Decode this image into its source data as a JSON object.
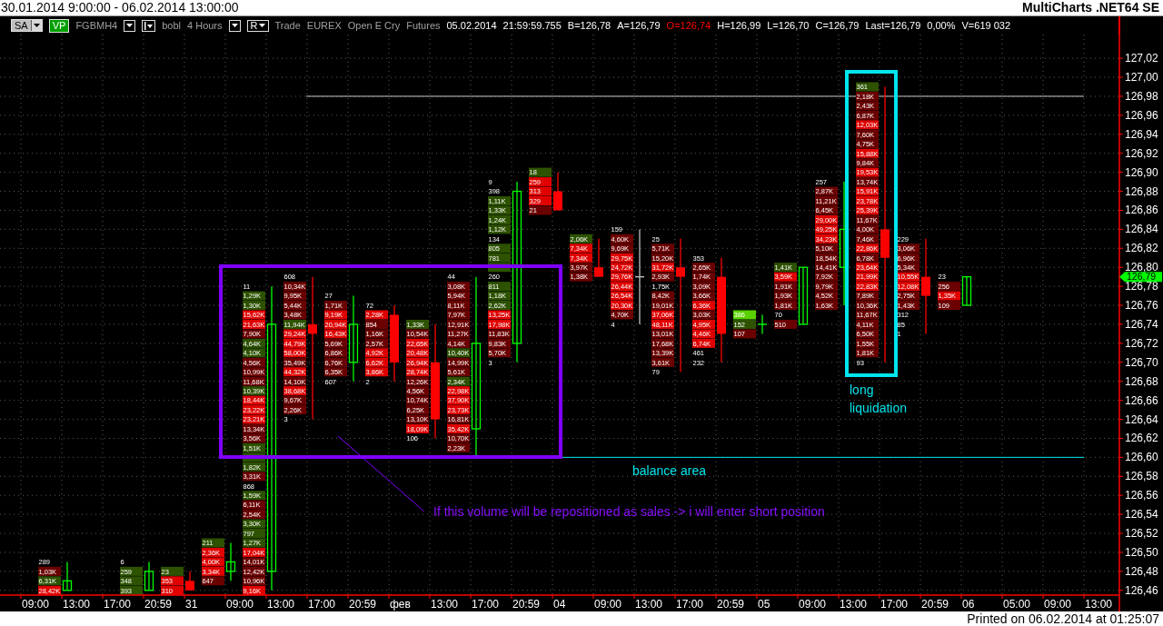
{
  "header": {
    "range": "30.01.2014 9:00:00 - 06.02.2014 13:00:00",
    "app": "MultiCharts .NET64 SE"
  },
  "toolbar": {
    "items": [
      {
        "kind": "dropdown",
        "label": "SA"
      },
      {
        "kind": "toggle",
        "label": "VP",
        "on": true
      },
      {
        "kind": "text",
        "text": "FGBMH4",
        "color": "#a0a0a0"
      },
      {
        "kind": "caret"
      },
      {
        "kind": "bar-caret"
      },
      {
        "kind": "text",
        "text": "bobl",
        "color": "#a0a0a0"
      },
      {
        "kind": "text",
        "text": "4 Hours",
        "color": "#a0a0a0"
      },
      {
        "kind": "caret"
      },
      {
        "kind": "letter-caret",
        "label": "R"
      },
      {
        "kind": "text",
        "text": "Trade",
        "color": "#a0a0a0"
      },
      {
        "kind": "text",
        "text": "EUREX",
        "color": "#a0a0a0"
      },
      {
        "kind": "text",
        "text": "Open E Cry",
        "color": "#a0a0a0"
      },
      {
        "kind": "text",
        "text": "Futures",
        "color": "#a0a0a0"
      },
      {
        "kind": "text",
        "text": "05.02.2014",
        "color": "#ffffff"
      },
      {
        "kind": "text",
        "text": "21:59:59.755",
        "color": "#ffffff"
      },
      {
        "kind": "text",
        "text": "B=126,78",
        "color": "#ffffff"
      },
      {
        "kind": "text",
        "text": "A=126,79",
        "color": "#ffffff"
      },
      {
        "kind": "text",
        "text": "O=126,74",
        "color": "#ff0000"
      },
      {
        "kind": "text",
        "text": "H=126,99",
        "color": "#ffffff"
      },
      {
        "kind": "text",
        "text": "L=126,70",
        "color": "#ffffff"
      },
      {
        "kind": "text",
        "text": "C=126,79",
        "color": "#ffffff"
      },
      {
        "kind": "text",
        "text": "Last=126,79",
        "color": "#ffffff"
      },
      {
        "kind": "text",
        "text": "0,00%",
        "color": "#ffffff"
      },
      {
        "kind": "text",
        "text": "V=619 032",
        "color": "#ffffff"
      }
    ]
  },
  "chart": {
    "last_price": "126,79",
    "chart_data": [
      {
        "type": "candlestick",
        "categories": [
          "09:00",
          "13:00",
          "17:00",
          "20:59",
          "31",
          "09:00",
          "13:00",
          "17:00",
          "20:59",
          "фев",
          "13:00",
          "17:00",
          "20:59",
          "04",
          "09:00",
          "13:00",
          "17:00",
          "20:59",
          "05",
          "09:00",
          "13:00",
          "17:00",
          "20:59",
          "06",
          "05:00",
          "09:00",
          "13:00"
        ],
        "ohlc": [
          null,
          [
            126.46,
            126.49,
            126.46,
            126.47
          ],
          null,
          [
            126.46,
            126.49,
            126.46,
            126.48
          ],
          [
            126.47,
            126.48,
            126.46,
            126.46
          ],
          [
            126.48,
            126.51,
            126.47,
            126.49
          ],
          [
            126.48,
            126.78,
            126.46,
            126.74
          ],
          [
            126.74,
            126.79,
            126.64,
            126.73
          ],
          [
            126.7,
            126.77,
            126.68,
            126.74
          ],
          [
            126.75,
            126.76,
            126.68,
            126.7
          ],
          [
            126.7,
            126.74,
            126.62,
            126.64
          ],
          [
            126.63,
            126.79,
            126.6,
            126.72
          ],
          [
            126.72,
            126.89,
            126.7,
            126.88
          ],
          [
            126.88,
            126.9,
            126.86,
            126.86
          ],
          [
            126.8,
            126.83,
            126.79,
            126.79
          ],
          [
            126.79,
            126.84,
            126.74,
            126.79
          ],
          [
            126.8,
            126.83,
            126.69,
            126.79
          ],
          [
            126.79,
            126.81,
            126.7,
            126.73
          ],
          [
            126.74,
            126.75,
            126.73,
            126.74
          ],
          [
            126.74,
            126.8,
            126.74,
            126.8
          ],
          [
            126.8,
            126.89,
            126.76,
            126.84
          ],
          [
            126.84,
            126.99,
            126.7,
            126.81
          ],
          [
            126.79,
            126.83,
            126.73,
            126.77
          ],
          [
            126.76,
            126.79,
            126.76,
            126.79
          ],
          null,
          null,
          null
        ],
        "colors": [
          null,
          "#00ff00",
          null,
          "#00ff00",
          "#ff0000",
          "#00ff00",
          "#00ff00",
          "#ff0000",
          "#00ff00",
          "#ff0000",
          "#ff0000",
          "#00ff00",
          "#00ff00",
          "#ff0000",
          "#ff0000",
          "#c0c0c0",
          "#ff0000",
          "#ff0000",
          "#00ff00",
          "#00ff00",
          "#00ff00",
          "#ff0000",
          "#ff0000",
          "#00ff00",
          null,
          null,
          null
        ],
        "value_labels": [
          null,
          [
            {
              "text": "289"
            },
            {
              "text": "1,03K",
              "color": "#6b0000"
            },
            {
              "text": "6,31K",
              "color": "#2d5200"
            },
            {
              "text": "28,42K",
              "color": "#e00000"
            }
          ],
          null,
          [
            {
              "text": "6"
            },
            {
              "text": "259",
              "color": "#2d5200"
            },
            {
              "text": "348",
              "color": "#2d5200"
            },
            {
              "text": "393",
              "color": "#2d5200"
            }
          ],
          [
            {
              "text": "23",
              "color": "#2d5200"
            },
            {
              "text": "353",
              "color": "#e00000"
            },
            {
              "text": "310",
              "color": "#e00000"
            }
          ],
          [
            {
              "text": "211",
              "color": "#2d5200"
            },
            {
              "text": "2,36K",
              "color": "#e00000"
            },
            {
              "text": "4,00K",
              "color": "#e00000"
            },
            {
              "text": "3,34K",
              "color": "#e00000"
            },
            {
              "text": "647",
              "color": "#6b0000"
            }
          ],
          [
            {
              "text": "11"
            },
            {
              "text": "1,29K",
              "color": "#2d5200"
            },
            {
              "text": "1,30K",
              "color": "#2d5200"
            },
            {
              "text": "15,62K",
              "color": "#e00000"
            },
            {
              "text": "21,63K",
              "color": "#e00000"
            },
            {
              "text": "7,90K",
              "color": "#6b0000"
            },
            {
              "text": "4,64K",
              "color": "#2d5200"
            },
            {
              "text": "4,10K",
              "color": "#2d5200"
            },
            {
              "text": "4,56K",
              "color": "#6b0000"
            },
            {
              "text": "10,99K",
              "color": "#6b0000"
            },
            {
              "text": "11,68K",
              "color": "#6b0000"
            },
            {
              "text": "10,39K",
              "color": "#2d5200"
            },
            {
              "text": "18,44K",
              "color": "#e00000"
            },
            {
              "text": "23,22K",
              "color": "#e00000"
            },
            {
              "text": "23,21K",
              "color": "#e00000"
            },
            {
              "text": "13,34K",
              "color": "#6b0000"
            },
            {
              "text": "3,56K",
              "color": "#6b0000"
            },
            {
              "text": "1,51K",
              "color": "#2d5200"
            },
            {
              "color": "#2d5200"
            },
            {
              "text": "1,82K",
              "color": "#2d5200"
            },
            {
              "text": "3,31K",
              "color": "#6b0000"
            },
            {
              "text": "868"
            },
            {
              "text": "1,59K",
              "color": "#2d5200"
            },
            {
              "text": "6,11K",
              "color": "#6b0000"
            },
            {
              "text": "2,54K",
              "color": "#6b0000"
            },
            {
              "text": "3,30K",
              "color": "#2d5200"
            },
            {
              "text": "797",
              "color": "#2d5200"
            },
            {
              "text": "1,27K",
              "color": "#2d5200"
            },
            {
              "text": "17,04K",
              "color": "#e00000"
            },
            {
              "text": "14,01K",
              "color": "#6b0000"
            },
            {
              "text": "12,42K",
              "color": "#6b0000"
            },
            {
              "text": "10,96K",
              "color": "#6b0000"
            },
            {
              "text": "9,16K",
              "color": "#e00000"
            }
          ],
          [
            {
              "text": "608"
            },
            {
              "text": "10,34K",
              "color": "#6b0000"
            },
            {
              "text": "9,95K",
              "color": "#6b0000"
            },
            {
              "text": "5,44K",
              "color": "#6b0000"
            },
            {
              "text": "3,48K",
              "color": "#6b0000"
            },
            {
              "text": "11,94K",
              "color": "#2d5200"
            },
            {
              "text": "29,24K",
              "color": "#e00000"
            },
            {
              "text": "44,79K",
              "color": "#e00000"
            },
            {
              "text": "58,00K",
              "color": "#e00000"
            },
            {
              "text": "35,49K",
              "color": "#6b0000"
            },
            {
              "text": "44,32K",
              "color": "#e00000"
            },
            {
              "text": "14,10K",
              "color": "#6b0000"
            },
            {
              "text": "38,68K",
              "color": "#e00000"
            },
            {
              "text": "9,67K",
              "color": "#6b0000"
            },
            {
              "text": "2,26K",
              "color": "#6b0000"
            },
            {
              "text": "3"
            }
          ],
          [
            {
              "text": "27"
            },
            {
              "text": "1,71K",
              "color": "#6b0000"
            },
            {
              "text": "9,19K",
              "color": "#e00000"
            },
            {
              "text": "20,94K",
              "color": "#e00000"
            },
            {
              "text": "16,43K",
              "color": "#e00000"
            },
            {
              "text": "5,69K",
              "color": "#6b0000"
            },
            {
              "text": "6,86K",
              "color": "#6b0000"
            },
            {
              "text": "6,76K",
              "color": "#6b0000"
            },
            {
              "text": "6,35K",
              "color": "#6b0000"
            },
            {
              "text": "607"
            }
          ],
          [
            {
              "text": "72"
            },
            {
              "text": "2,28K",
              "color": "#e00000"
            },
            {
              "text": "854",
              "color": "#6b0000"
            },
            {
              "text": "1,16K",
              "color": "#6b0000"
            },
            {
              "text": "2,57K",
              "color": "#6b0000"
            },
            {
              "text": "4,92K",
              "color": "#e00000"
            },
            {
              "text": "6,62K",
              "color": "#e00000"
            },
            {
              "text": "3,86K",
              "color": "#e00000"
            },
            {
              "text": "2"
            }
          ],
          [
            {
              "text": "1,33K",
              "color": "#2d5200"
            },
            {
              "text": "10,54K",
              "color": "#6b0000"
            },
            {
              "text": "22,65K",
              "color": "#e00000"
            },
            {
              "text": "20,48K",
              "color": "#e00000"
            },
            {
              "text": "26,94K",
              "color": "#e00000"
            },
            {
              "text": "28,74K",
              "color": "#e00000"
            },
            {
              "text": "12,26K",
              "color": "#6b0000"
            },
            {
              "text": "4,56K",
              "color": "#6b0000"
            },
            {
              "text": "10,74K",
              "color": "#6b0000"
            },
            {
              "text": "6,25K",
              "color": "#6b0000"
            },
            {
              "text": "13,10K",
              "color": "#6b0000"
            },
            {
              "text": "18,09K",
              "color": "#e00000"
            },
            {
              "text": "106"
            }
          ],
          [
            {
              "text": "44"
            },
            {
              "text": "3,08K",
              "color": "#6b0000"
            },
            {
              "text": "5,94K",
              "color": "#6b0000"
            },
            {
              "text": "8,11K",
              "color": "#6b0000"
            },
            {
              "text": "7,97K",
              "color": "#6b0000"
            },
            {
              "text": "12,91K",
              "color": "#6b0000"
            },
            {
              "text": "11,27K",
              "color": "#6b0000"
            },
            {
              "text": "4,14K",
              "color": "#6b0000"
            },
            {
              "text": "10,40K",
              "color": "#2d5200"
            },
            {
              "text": "14,99K",
              "color": "#6b0000"
            },
            {
              "text": "5,61K",
              "color": "#6b0000"
            },
            {
              "text": "2,34K",
              "color": "#2d5200"
            },
            {
              "text": "22,98K",
              "color": "#e00000"
            },
            {
              "text": "37,90K",
              "color": "#e00000"
            },
            {
              "text": "23,73K",
              "color": "#e00000"
            },
            {
              "text": "16,81K",
              "color": "#6b0000"
            },
            {
              "text": "35,42K",
              "color": "#e00000"
            },
            {
              "text": "10,70K",
              "color": "#6b0000"
            },
            {
              "text": "2,23K",
              "color": "#6b0000"
            }
          ],
          [
            {
              "text": "9"
            },
            {
              "text": "398"
            },
            {
              "text": "1,11K",
              "color": "#2d5200"
            },
            {
              "text": "1,33K",
              "color": "#2d5200"
            },
            {
              "text": "1,24K",
              "color": "#2d5200"
            },
            {
              "text": "1,12K",
              "color": "#2d5200"
            },
            {
              "text": "134"
            },
            {
              "text": "805",
              "color": "#2d5200"
            },
            {
              "text": "781",
              "color": "#2d5200"
            },
            {
              "color": "#2d5200"
            },
            {
              "text": "260"
            },
            {
              "text": "811",
              "color": "#2d5200"
            },
            {
              "text": "1,18K",
              "color": "#2d5200"
            },
            {
              "text": "2,62K",
              "color": "#2d5200"
            },
            {
              "text": "13,25K",
              "color": "#e00000"
            },
            {
              "text": "17,98K",
              "color": "#e00000"
            },
            {
              "text": "11,83K",
              "color": "#6b0000"
            },
            {
              "text": "9,83K",
              "color": "#6b0000"
            },
            {
              "text": "5,70K",
              "color": "#6b0000"
            },
            {
              "text": "3"
            }
          ],
          [
            {
              "text": "18",
              "color": "#2d5200"
            },
            {
              "text": "259",
              "color": "#e00000"
            },
            {
              "text": "313",
              "color": "#e00000"
            },
            {
              "text": "329",
              "color": "#e00000"
            },
            {
              "text": "21",
              "color": "#6b0000"
            }
          ],
          [
            {
              "text": "2,06K",
              "color": "#2d5200"
            },
            {
              "text": "7,34K",
              "color": "#e00000"
            },
            {
              "text": "7,34K",
              "color": "#e00000"
            },
            {
              "text": "3,97K",
              "color": "#6b0000"
            },
            {
              "text": "1,38K",
              "color": "#6b0000"
            }
          ],
          [
            {
              "text": "159"
            },
            {
              "text": "4,60K",
              "color": "#6b0000"
            },
            {
              "text": "9,69K",
              "color": "#6b0000"
            },
            {
              "text": "29,75K",
              "color": "#e00000"
            },
            {
              "text": "24,72K",
              "color": "#e00000"
            },
            {
              "text": "29,76K",
              "color": "#e00000"
            },
            {
              "text": "26,44K",
              "color": "#e00000"
            },
            {
              "text": "26,54K",
              "color": "#e00000"
            },
            {
              "text": "20,30K",
              "color": "#e00000"
            },
            {
              "text": "4,70K",
              "color": "#6b0000"
            },
            {
              "text": "4"
            }
          ],
          [
            {
              "text": "25"
            },
            {
              "text": "5,71K",
              "color": "#6b0000"
            },
            {
              "text": "15,20K",
              "color": "#6b0000"
            },
            {
              "text": "31,72K",
              "color": "#e00000"
            },
            {
              "text": "2,93K",
              "color": "#6b0000"
            },
            {
              "text": "1,75K"
            },
            {
              "text": "8,42K",
              "color": "#6b0000"
            },
            {
              "text": "19,01K",
              "color": "#6b0000"
            },
            {
              "text": "37,06K",
              "color": "#e00000"
            },
            {
              "text": "48,11K",
              "color": "#e00000"
            },
            {
              "text": "13,01K",
              "color": "#6b0000"
            },
            {
              "text": "17,68K",
              "color": "#6b0000"
            },
            {
              "text": "13,39K",
              "color": "#6b0000"
            },
            {
              "text": "3,61K",
              "color": "#6b0000"
            },
            {
              "text": "79"
            }
          ],
          [
            {
              "text": "353"
            },
            {
              "text": "2,65K",
              "color": "#6b0000"
            },
            {
              "text": "1,74K",
              "color": "#6b0000"
            },
            {
              "text": "3,09K",
              "color": "#6b0000"
            },
            {
              "text": "3,66K",
              "color": "#6b0000"
            },
            {
              "text": "6,36K",
              "color": "#e00000"
            },
            {
              "text": "3,03K",
              "color": "#6b0000"
            },
            {
              "text": "4,95K",
              "color": "#e00000"
            },
            {
              "text": "4,46K",
              "color": "#e00000"
            },
            {
              "text": "6,74K",
              "color": "#e00000"
            },
            {
              "text": "461"
            },
            {
              "text": "232"
            }
          ],
          [
            {
              "text": "386",
              "color": "#5ad200"
            },
            {
              "text": "152",
              "color": "#2d5200"
            },
            {
              "text": "107",
              "color": "#6b0000"
            }
          ],
          [
            {
              "text": "1,41K",
              "color": "#2d5200"
            },
            {
              "text": "3,59K",
              "color": "#e00000"
            },
            {
              "text": "1,91K",
              "color": "#6b0000"
            },
            {
              "text": "1,93K",
              "color": "#6b0000"
            },
            {
              "text": "1,81K",
              "color": "#6b0000"
            },
            {
              "text": "70"
            },
            {
              "text": "510",
              "color": "#6b0000"
            }
          ],
          [
            {
              "text": "257"
            },
            {
              "text": "2,87K",
              "color": "#6b0000"
            },
            {
              "text": "11,21K",
              "color": "#6b0000"
            },
            {
              "text": "6,45K",
              "color": "#6b0000"
            },
            {
              "text": "29,00K",
              "color": "#e00000"
            },
            {
              "text": "49,25K",
              "color": "#e00000"
            },
            {
              "text": "34,23K",
              "color": "#e00000"
            },
            {
              "text": "5,10K",
              "color": "#6b0000"
            },
            {
              "text": "18,54K",
              "color": "#6b0000"
            },
            {
              "text": "14,41K",
              "color": "#6b0000"
            },
            {
              "text": "7,92K",
              "color": "#6b0000"
            },
            {
              "text": "9,79K",
              "color": "#6b0000"
            },
            {
              "text": "4,52K",
              "color": "#6b0000"
            },
            {
              "text": "1,63K",
              "color": "#6b0000"
            }
          ],
          [
            {
              "text": "361",
              "color": "#2d5200"
            },
            {
              "text": "2,18K",
              "color": "#6b0000"
            },
            {
              "text": "2,43K",
              "color": "#6b0000"
            },
            {
              "text": "6,87K",
              "color": "#6b0000"
            },
            {
              "text": "12,03K",
              "color": "#e00000"
            },
            {
              "text": "7,60K",
              "color": "#6b0000"
            },
            {
              "text": "4,75K",
              "color": "#6b0000"
            },
            {
              "text": "15,88K",
              "color": "#e00000"
            },
            {
              "text": "9,84K",
              "color": "#6b0000"
            },
            {
              "text": "19,53K",
              "color": "#e00000"
            },
            {
              "text": "13,74K",
              "color": "#6b0000"
            },
            {
              "text": "15,91K",
              "color": "#e00000"
            },
            {
              "text": "23,78K",
              "color": "#e00000"
            },
            {
              "text": "25,39K",
              "color": "#e00000"
            },
            {
              "text": "11,67K",
              "color": "#6b0000"
            },
            {
              "text": "4,00K",
              "color": "#6b0000"
            },
            {
              "text": "7,46K",
              "color": "#6b0000"
            },
            {
              "text": "22,86K",
              "color": "#e00000"
            },
            {
              "text": "6,78K",
              "color": "#6b0000"
            },
            {
              "text": "23,64K",
              "color": "#e00000"
            },
            {
              "text": "21,99K",
              "color": "#e00000"
            },
            {
              "text": "22,83K",
              "color": "#e00000"
            },
            {
              "text": "7,89K",
              "color": "#6b0000"
            },
            {
              "text": "10,36K",
              "color": "#6b0000"
            },
            {
              "text": "11,67K",
              "color": "#6b0000"
            },
            {
              "text": "4,11K",
              "color": "#6b0000"
            },
            {
              "text": "6,50K",
              "color": "#6b0000"
            },
            {
              "text": "1,55K",
              "color": "#6b0000"
            },
            {
              "text": "1,81K",
              "color": "#6b0000"
            },
            {
              "text": "93"
            }
          ],
          [
            {
              "text": "229"
            },
            {
              "text": "3,06K",
              "color": "#6b0000"
            },
            {
              "text": "6,96K",
              "color": "#6b0000"
            },
            {
              "text": "5,34K",
              "color": "#6b0000"
            },
            {
              "text": "10,55K",
              "color": "#e00000"
            },
            {
              "text": "12,08K",
              "color": "#e00000"
            },
            {
              "text": "2,75K",
              "color": "#6b0000"
            },
            {
              "text": "1,43K",
              "color": "#6b0000"
            },
            {
              "text": "312"
            },
            {
              "text": "85"
            },
            {
              "text": "1"
            }
          ],
          [
            {
              "text": "23"
            },
            {
              "text": "256",
              "color": "#6b0000"
            },
            {
              "text": "1,35K",
              "color": "#e00000"
            },
            {
              "text": "109",
              "color": "#6b0000"
            }
          ],
          null,
          null,
          null
        ],
        "yticks": [
          {
            "value": 127.02,
            "label": "127,02"
          },
          {
            "value": 127.0,
            "label": "127,00"
          },
          {
            "value": 126.98,
            "label": "126,98"
          },
          {
            "value": 126.96,
            "label": "126,96"
          },
          {
            "value": 126.94,
            "label": "126,94"
          },
          {
            "value": 126.92,
            "label": "126,92"
          },
          {
            "value": 126.9,
            "label": "126,90"
          },
          {
            "value": 126.88,
            "label": "126,88"
          },
          {
            "value": 126.86,
            "label": "126,86"
          },
          {
            "value": 126.84,
            "label": "126,84"
          },
          {
            "value": 126.82,
            "label": "126,82"
          },
          {
            "value": 126.8,
            "label": "126,80"
          },
          {
            "value": 126.78,
            "label": "126,78"
          },
          {
            "value": 126.76,
            "label": "126,76"
          },
          {
            "value": 126.74,
            "label": "126,74"
          },
          {
            "value": 126.72,
            "label": "126,72"
          },
          {
            "value": 126.7,
            "label": "126,70"
          },
          {
            "value": 126.68,
            "label": "126,68"
          },
          {
            "value": 126.66,
            "label": "126,66"
          },
          {
            "value": 126.64,
            "label": "126,64"
          },
          {
            "value": 126.62,
            "label": "126,62"
          },
          {
            "value": 126.6,
            "label": "126,60"
          },
          {
            "value": 126.58,
            "label": "126,58"
          },
          {
            "value": 126.56,
            "label": "126,56"
          },
          {
            "value": 126.54,
            "label": "126,54"
          },
          {
            "value": 126.52,
            "label": "126,52"
          },
          {
            "value": 126.5,
            "label": "126,50"
          },
          {
            "value": 126.48,
            "label": "126,48"
          },
          {
            "value": 126.46,
            "label": "126,46"
          }
        ],
        "ylim": [
          126.455,
          127.045
        ],
        "grid": true,
        "ref_lines": [
          {
            "axis": "y",
            "value": 126.98,
            "color": "#c8c8c8"
          },
          {
            "axis": "y",
            "value": 126.6,
            "label": "balance area",
            "color": "#00e5ee"
          }
        ],
        "annotations": [
          "If this volume will be repositioned as sales -> i will enter short position",
          "long liquidation"
        ]
      }
    ]
  },
  "footer": {
    "text": "Printed on 06.02.2014 at 01:25:07"
  }
}
